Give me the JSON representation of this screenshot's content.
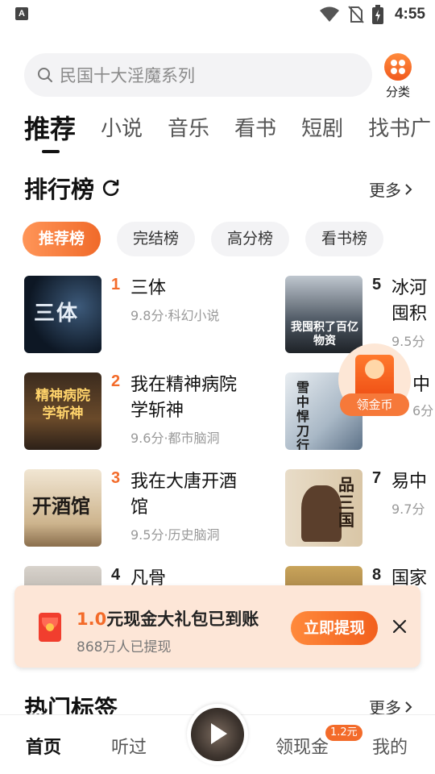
{
  "status_bar": {
    "time": "4:55",
    "left_icon_label": "A",
    "icons": [
      "wifi-icon",
      "no-sim-icon",
      "battery-charging-icon"
    ]
  },
  "search": {
    "placeholder": "民国十大淫魔系列",
    "icon": "search-icon"
  },
  "category": {
    "label": "分类",
    "icon": "dots-grid-icon"
  },
  "tabs": [
    {
      "label": "推荐",
      "active": true
    },
    {
      "label": "小说"
    },
    {
      "label": "音乐"
    },
    {
      "label": "看书"
    },
    {
      "label": "短剧"
    },
    {
      "label": "找书广"
    }
  ],
  "ranking": {
    "title": "排行榜",
    "more": "更多",
    "chips": [
      "推荐榜",
      "完结榜",
      "高分榜",
      "看书榜"
    ],
    "items": [
      {
        "rank": "1",
        "name": "三体",
        "meta": "9.8分·科幻小说",
        "cover_text": "三体"
      },
      {
        "rank": "2",
        "name": "我在精神病院学斩神",
        "meta": "9.6分·都市脑洞",
        "cover_text": "精神病院学斩神"
      },
      {
        "rank": "3",
        "name": "我在大唐开酒馆",
        "meta": "9.5分·历史脑洞",
        "cover_text": "开酒馆"
      },
      {
        "rank": "4",
        "name": "凡骨",
        "meta": "",
        "cover_text": ""
      },
      {
        "rank": "5",
        "name": "冰河\n囤积",
        "meta": "9.5分",
        "cover_text": "我囤积了百亿物资"
      },
      {
        "rank": "",
        "name": "中",
        "meta": "6分",
        "cover_text": "雪中悍刀行"
      },
      {
        "rank": "7",
        "name": "易中",
        "meta": "9.7分",
        "cover_text": "品三国"
      },
      {
        "rank": "8",
        "name": "国家",
        "meta": "",
        "cover_text": ""
      }
    ]
  },
  "float_coin": {
    "label": "领金币"
  },
  "banner": {
    "amount": "1.0",
    "title_rest": "元现金大礼包已到账",
    "subtitle": "868万人已提现",
    "button": "立即提现"
  },
  "hot_tags": {
    "title": "热门标签",
    "more": "更多"
  },
  "nav": {
    "home": "首页",
    "listened": "听过",
    "earn": "领现金",
    "earn_badge": "1.2元",
    "mine": "我的"
  },
  "colors": {
    "accent": "#f36b2a",
    "chip_active_start": "#ff9558",
    "chip_active_end": "#f06a2a",
    "banner_bg": "#fde6d7"
  }
}
